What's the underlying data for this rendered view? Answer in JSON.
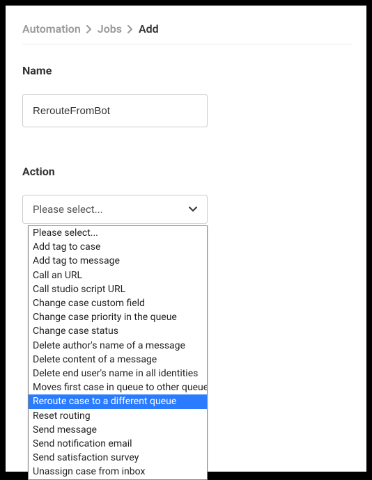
{
  "breadcrumb": {
    "items": [
      "Automation",
      "Jobs",
      "Add"
    ],
    "current_index": 2
  },
  "fields": {
    "name": {
      "label": "Name",
      "value": "RerouteFromBot"
    },
    "action": {
      "label": "Action",
      "selected_label": "Please select...",
      "options": [
        "Please select...",
        "Add tag to case",
        "Add tag to message",
        "Call an URL",
        "Call studio script URL",
        "Change case custom field",
        "Change case priority in the queue",
        "Change case status",
        "Delete author's name of a message",
        "Delete content of a message",
        "Delete end user's name in all identities",
        "Moves first case in queue to other queue",
        "Reroute case to a different queue",
        "Reset routing",
        "Send message",
        "Send notification email",
        "Send satisfaction survey",
        "Unassign case from inbox"
      ],
      "highlighted_index": 12
    }
  }
}
